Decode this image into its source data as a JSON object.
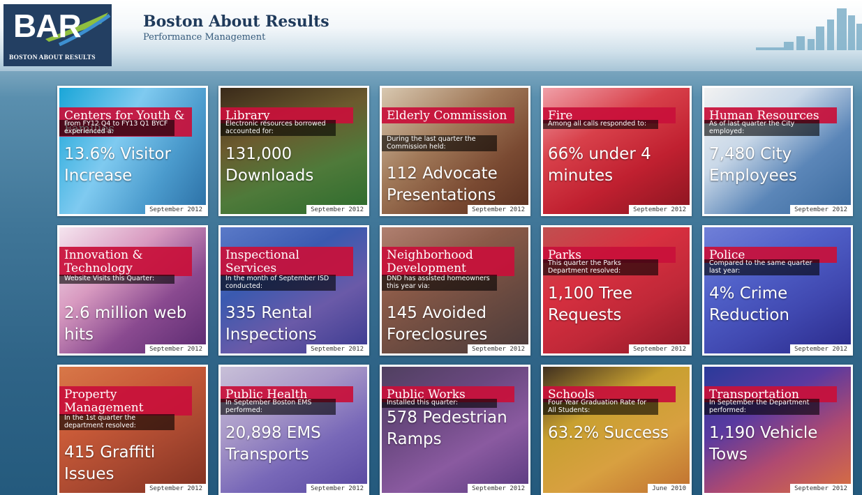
{
  "header": {
    "logo_mark": "BAR",
    "logo_text": "BOSTON ABOUT RESULTS",
    "title": "Boston About Results",
    "subtitle": "Performance Management"
  },
  "tiles": [
    {
      "title": "Centers for Youth & Families",
      "desc": "From FY12 Q4 to FY13 Q1 BYCF experienced a:",
      "value": "13.6% Visitor Increase",
      "date": "September 2012"
    },
    {
      "title": "Library",
      "desc": "Electronic resources borrowed accounted for:",
      "value": "131,000 Downloads",
      "date": "September 2012"
    },
    {
      "title": "Elderly Commission",
      "desc": "During the last quarter the Commission held:",
      "value": "112 Advocate Presentations",
      "date": "September 2012"
    },
    {
      "title": "Fire",
      "desc": "Among all calls responded to:",
      "value": "66% under 4 minutes",
      "date": "September 2012"
    },
    {
      "title": "Human Resources",
      "desc": "As of last quarter the City employed:",
      "value": "7,480 City Employees",
      "date": "September 2012"
    },
    {
      "title": "Innovation & Technology",
      "desc": "Website Visits this Quarter:",
      "value": "2.6 million web hits",
      "date": "September 2012"
    },
    {
      "title": "Inspectional Services",
      "desc": "In the month of September ISD conducted:",
      "value": "335 Rental Inspections",
      "date": "September 2012"
    },
    {
      "title": "Neighborhood Development",
      "desc": "DND has assisted homeowners this year via:",
      "value": "145 Avoided Foreclosures",
      "date": "September 2012"
    },
    {
      "title": "Parks",
      "desc": "This quarter the Parks Department resolved:",
      "value": "1,100 Tree Requests",
      "date": "September 2012"
    },
    {
      "title": "Police",
      "desc": "Compared to the same quarter last year:",
      "value": "4% Crime Reduction",
      "date": "September 2012"
    },
    {
      "title": "Property Management",
      "desc": "In the 1st quarter the department resolved:",
      "value": "415 Graffiti Issues",
      "date": "September 2012"
    },
    {
      "title": "Public Health",
      "desc": "In September Boston EMS performed:",
      "value": "20,898 EMS Transports",
      "date": "September 2012"
    },
    {
      "title": "Public Works",
      "desc": "Installed this quarter:",
      "value": "578 Pedestrian Ramps",
      "date": "September 2012"
    },
    {
      "title": "Schools",
      "desc": "Four Year Graduation Rate for All Students:",
      "value": "63.2% Success",
      "date": "June 2010"
    },
    {
      "title": "Transportation",
      "desc": "In September the Department performed:",
      "value": "1,190 Vehicle Tows",
      "date": "September 2012"
    }
  ]
}
